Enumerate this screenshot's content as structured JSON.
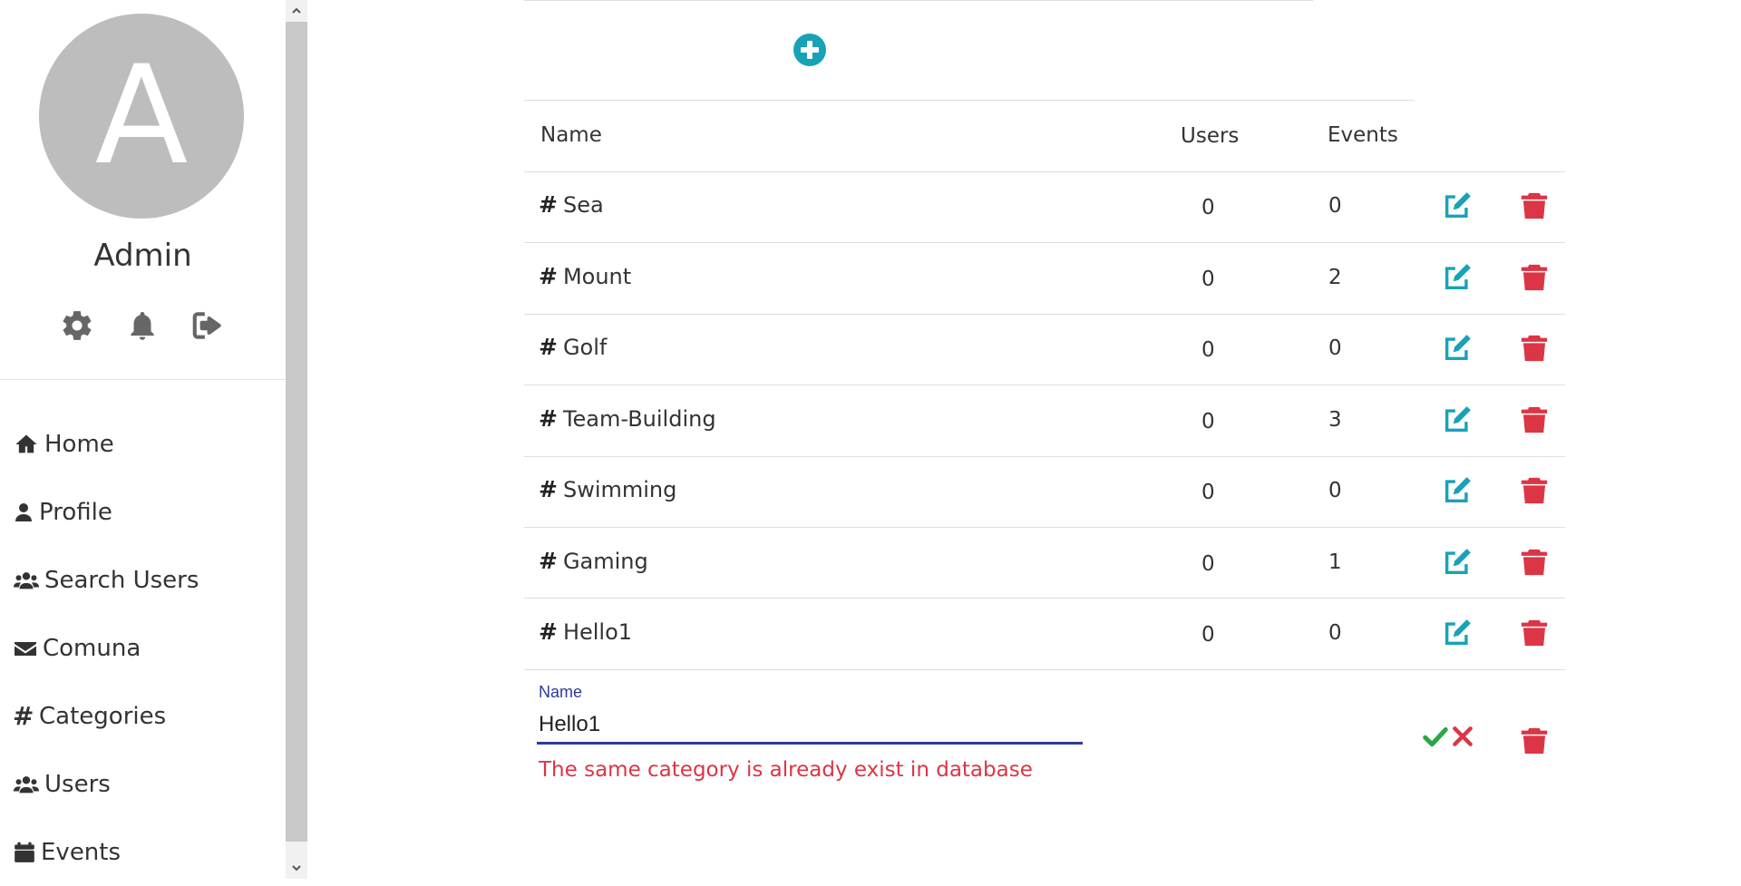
{
  "profile": {
    "avatar_letter": "A",
    "name": "Admin"
  },
  "profile_actions": [
    {
      "icon": "gear-icon"
    },
    {
      "icon": "bell-icon"
    },
    {
      "icon": "sign-out-icon"
    }
  ],
  "nav": [
    {
      "label": "Home",
      "icon": "home-icon"
    },
    {
      "label": "Profile",
      "icon": "user-icon"
    },
    {
      "label": "Search Users",
      "icon": "users-icon"
    },
    {
      "label": "Comuna",
      "icon": "envelope-icon"
    },
    {
      "label": "Categories",
      "icon": "hashtag-icon"
    },
    {
      "label": "Users",
      "icon": "users-icon"
    },
    {
      "label": "Events",
      "icon": "calendar-icon"
    }
  ],
  "table": {
    "headers": {
      "name": "Name",
      "users": "Users",
      "events": "Events"
    },
    "rows": [
      {
        "name": "Sea",
        "users": "0",
        "events": "0"
      },
      {
        "name": "Mount",
        "users": "0",
        "events": "2"
      },
      {
        "name": "Golf",
        "users": "0",
        "events": "0"
      },
      {
        "name": "Team-Building",
        "users": "0",
        "events": "3"
      },
      {
        "name": "Swimming",
        "users": "0",
        "events": "0"
      },
      {
        "name": "Gaming",
        "users": "0",
        "events": "1"
      },
      {
        "name": "Hello1",
        "users": "0",
        "events": "0"
      }
    ]
  },
  "edit_row": {
    "label": "Name",
    "value": "Hello1",
    "error": "The same category is already exist in database"
  },
  "colors": {
    "accent": "#17a2b8",
    "danger": "#dc3545",
    "success": "#28a745",
    "input_focus": "#2f3a9b",
    "avatar_bg": "#bdbdbd",
    "icon_gray": "#666666"
  }
}
